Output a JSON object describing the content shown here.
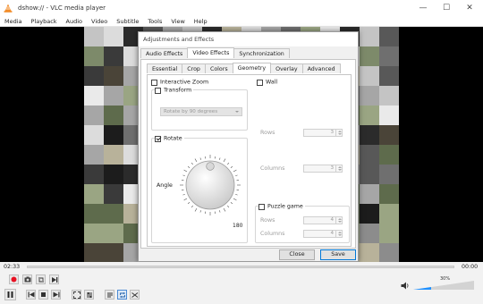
{
  "app": {
    "title": "dshow:// - VLC media player",
    "menu": [
      "Media",
      "Playback",
      "Audio",
      "Video",
      "Subtitle",
      "Tools",
      "View",
      "Help"
    ],
    "window_controls": {
      "minimize": "—",
      "maximize": "☐",
      "close": "✕"
    }
  },
  "dialog": {
    "title": "Adjustments and Effects",
    "tabs": [
      {
        "label": "Audio Effects",
        "active": false
      },
      {
        "label": "Video Effects",
        "active": true
      },
      {
        "label": "Synchronization",
        "active": false
      }
    ],
    "subtabs": [
      {
        "label": "Essential",
        "active": false
      },
      {
        "label": "Crop",
        "active": false
      },
      {
        "label": "Colors",
        "active": false
      },
      {
        "label": "Geometry",
        "active": true
      },
      {
        "label": "Overlay",
        "active": false
      },
      {
        "label": "Advanced",
        "active": false
      }
    ],
    "interactive_zoom": {
      "label": "Interactive Zoom",
      "checked": false
    },
    "transform": {
      "label": "Transform",
      "checked": false,
      "combo_value": "Rotate by 90 degrees"
    },
    "rotate": {
      "label": "Rotate",
      "checked": true,
      "angle_label": "Angle",
      "dial_value": "180"
    },
    "wall": {
      "label": "Wall",
      "checked": false,
      "rows_label": "Rows",
      "rows_value": "3",
      "columns_label": "Columns",
      "columns_value": "3"
    },
    "puzzle": {
      "label": "Puzzle game",
      "checked": false,
      "rows_label": "Rows",
      "rows_value": "4",
      "columns_label": "Columns",
      "columns_value": "4"
    },
    "buttons": {
      "close": "Close",
      "save": "Save"
    }
  },
  "player": {
    "elapsed": "02:33",
    "total": "00:00",
    "volume": "30%",
    "volume_level": 0.3
  },
  "icons": {
    "record": "record-icon",
    "snapshot": "camera-icon",
    "loop_ab": "loop-ab-icon",
    "frame_step": "frame-step-icon",
    "play": "play-pause-icon",
    "prev": "previous-icon",
    "stop": "stop-icon",
    "next": "next-icon",
    "fullscreen": "fullscreen-icon",
    "ext_settings": "extended-settings-icon",
    "playlist": "playlist-icon",
    "loop": "loop-icon",
    "shuffle": "shuffle-icon",
    "mute": "speaker-icon"
  },
  "colors": {
    "accent": "#1e90ff",
    "record": "#e81123",
    "vlc_orange": "#f28c28"
  }
}
